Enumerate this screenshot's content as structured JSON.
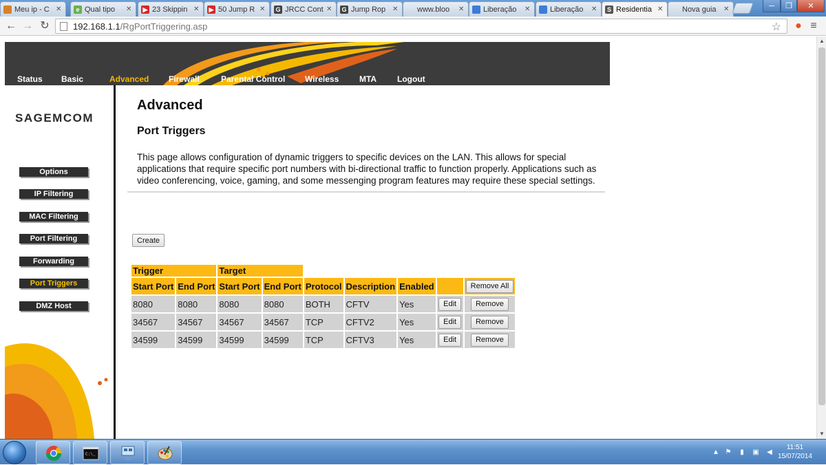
{
  "browser": {
    "tabs": [
      {
        "label": "Meu ip - C",
        "favicon_color": "#d9812a",
        "favicon_char": ""
      },
      {
        "label": "Qual tipo",
        "favicon_color": "#6ab04c",
        "favicon_char": "e"
      },
      {
        "label": "23 Skippin",
        "favicon_color": "#d42a2a",
        "favicon_char": "▶"
      },
      {
        "label": "50 Jump R",
        "favicon_color": "#d42a2a",
        "favicon_char": "▶"
      },
      {
        "label": "JRCC Cont",
        "favicon_color": "#444444",
        "favicon_char": "G"
      },
      {
        "label": "Jump Rop",
        "favicon_color": "#444444",
        "favicon_char": "G"
      },
      {
        "label": "www.bloo",
        "favicon_color": "",
        "favicon_char": ""
      },
      {
        "label": "Liberação",
        "favicon_color": "#3b7dd8",
        "favicon_char": ""
      },
      {
        "label": "Liberação",
        "favicon_color": "#3b7dd8",
        "favicon_char": ""
      },
      {
        "label": "Residentia",
        "favicon_color": "#555555",
        "favicon_char": "S",
        "active": true
      },
      {
        "label": "Nova guia",
        "favicon_color": "",
        "favicon_char": ""
      }
    ],
    "url_host": "192.168.1.1",
    "url_path": "/RgPortTriggering.asp"
  },
  "topnav": {
    "items": [
      "Status",
      "Basic",
      "Advanced",
      "Firewall",
      "Parental Control",
      "Wireless",
      "MTA",
      "Logout"
    ],
    "active": "Advanced"
  },
  "sidebar": {
    "logo": "SAGEMCOM",
    "items": [
      "Options",
      "IP Filtering",
      "MAC Filtering",
      "Port Filtering",
      "Forwarding",
      "Port Triggers",
      "DMZ Host"
    ],
    "active": "Port Triggers"
  },
  "content": {
    "title": "Advanced",
    "section": "Port Triggers",
    "description": "This page allows configuration of dynamic triggers to specific devices on the LAN. This allows for special applications that require specific port numbers with bi-directional traffic to function properly. Applications such as video conferencing, voice, gaming, and some messenging program features may require these special settings.",
    "create_label": "Create"
  },
  "table": {
    "group_headers": [
      "Trigger",
      "Target"
    ],
    "columns": [
      "Start Port",
      "End Port",
      "Start Port",
      "End Port",
      "Protocol",
      "Description",
      "Enabled"
    ],
    "remove_all_label": "Remove All",
    "edit_label": "Edit",
    "remove_label": "Remove",
    "rows": [
      [
        "8080",
        "8080",
        "8080",
        "8080",
        "BOTH",
        "CFTV",
        "Yes"
      ],
      [
        "34567",
        "34567",
        "34567",
        "34567",
        "TCP",
        "CFTV2",
        "Yes"
      ],
      [
        "34599",
        "34599",
        "34599",
        "34599",
        "TCP",
        "CFTV3",
        "Yes"
      ]
    ]
  },
  "taskbar": {
    "time": "11:51",
    "date": "15/07/2014"
  },
  "colors": {
    "accent": "#fdb913",
    "header_bg": "#3c3c3c",
    "active_nav": "#f5b800"
  }
}
